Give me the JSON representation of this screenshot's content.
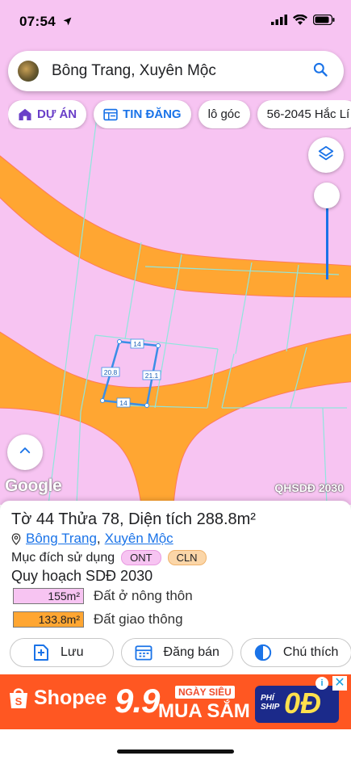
{
  "status": {
    "time": "07:54"
  },
  "search": {
    "query": "Bông Trang, Xuyên Mộc"
  },
  "chips": [
    {
      "label": "DỰ ÁN",
      "icon": "home-icon"
    },
    {
      "label": "TIN ĐĂNG",
      "icon": "listing-icon"
    },
    {
      "label": "lô góc"
    },
    {
      "label": "56-2045 Hắc Lí"
    }
  ],
  "map": {
    "attribution": "Google",
    "layer_tag": "QHSDĐ 2030",
    "parcel_edges": {
      "top": "14",
      "left": "20.8",
      "right": "21.1",
      "bottom": "14"
    },
    "colors": {
      "residential": "#f7c4f2",
      "road": "#ffa632",
      "parcel": "#3a8ee6"
    }
  },
  "parcel": {
    "title": "Tờ 44 Thửa 78, Diện tích 288.8m²",
    "commune": "Bông Trang",
    "district": "Xuyên Mộc",
    "separator": ",",
    "purpose_label": "Mục đích sử dụng",
    "purpose_codes": [
      "ONT",
      "CLN"
    ],
    "plan_title": "Quy hoạch SDĐ 2030",
    "legend": [
      {
        "area": "155m²",
        "label": "Đất ở nông thôn",
        "color": "#f7c4f2"
      },
      {
        "area": "133.8m²",
        "label": "Đất giao thông",
        "color": "#ffa632"
      }
    ]
  },
  "actions": [
    {
      "label": "Lưu",
      "icon": "bookmark-add-icon"
    },
    {
      "label": "Đăng bán",
      "icon": "calendar-icon"
    },
    {
      "label": "Chú thích",
      "icon": "half-circle-icon"
    },
    {
      "label": "",
      "icon": "add-photo-icon"
    }
  ],
  "ad": {
    "brand": "Shopee",
    "big": "9.9",
    "tag": "NGÀY SIÊU",
    "sale": "MUA SẮM",
    "ship_top": "PHÍ",
    "ship_bottom": "SHIP",
    "ship_value": "0Đ",
    "info": "i",
    "close": "✕"
  }
}
